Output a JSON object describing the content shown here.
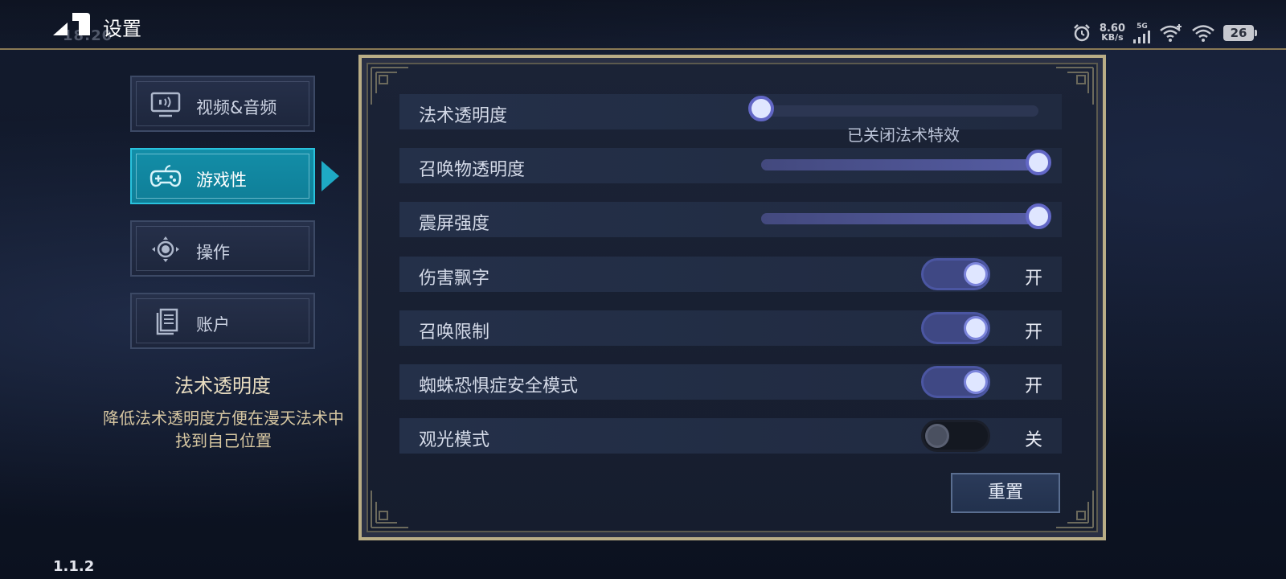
{
  "header": {
    "title": "设置",
    "clock": "18:20"
  },
  "status_bar": {
    "net_speed_value": "8.60",
    "net_speed_unit": "KB/s",
    "network_type": "5G",
    "battery": "26",
    "icons": [
      "alarm-icon",
      "signal-icon",
      "wifi-plus-icon",
      "wifi-icon",
      "battery-icon"
    ]
  },
  "nav": {
    "items": [
      {
        "label": "视频&音频",
        "icon": "monitor-audio-icon",
        "active": false
      },
      {
        "label": "游戏性",
        "icon": "gamepad-icon",
        "active": true
      },
      {
        "label": "操作",
        "icon": "dpad-icon",
        "active": false
      },
      {
        "label": "账户",
        "icon": "document-icon",
        "active": false
      }
    ]
  },
  "description": {
    "title": "法术透明度",
    "text": "降低法术透明度方便在漫天法术中找到自己位置"
  },
  "version": "1.1.2",
  "settings": {
    "spell_transparency": {
      "label": "法术透明度",
      "value": 0.0,
      "note": "已关闭法术特效"
    },
    "summon_transparency": {
      "label": "召唤物透明度",
      "value": 1.0
    },
    "screen_shake": {
      "label": "震屏强度",
      "value": 1.0
    },
    "damage_numbers": {
      "label": "伤害飘字",
      "state": "开",
      "on": true
    },
    "summon_limit": {
      "label": "召唤限制",
      "state": "开",
      "on": true
    },
    "arachnophobia_mode": {
      "label": "蜘蛛恐惧症安全模式",
      "state": "开",
      "on": true
    },
    "spectator_mode": {
      "label": "观光模式",
      "state": "关",
      "on": false
    }
  },
  "reset_label": "重置",
  "colors": {
    "accent_active": "#138ea8",
    "panel_border": "#b9ad86",
    "toggle_on": "#3f4884",
    "knob": "#dfe6ff"
  }
}
